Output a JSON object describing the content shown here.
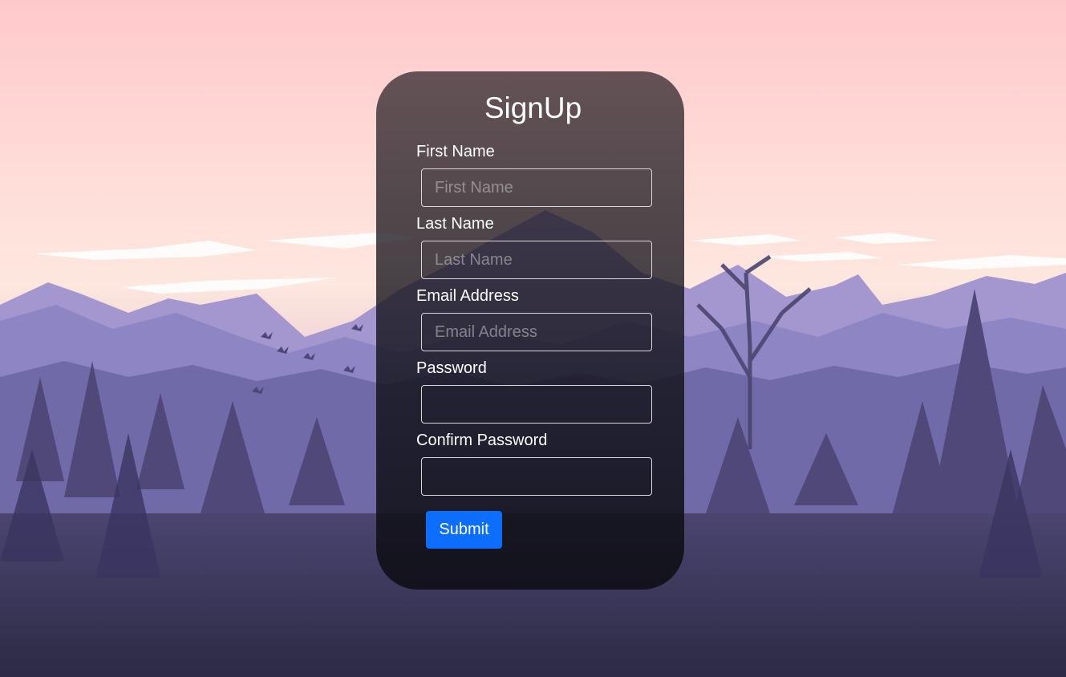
{
  "form": {
    "title": "SignUp",
    "fields": [
      {
        "label": "First Name",
        "placeholder": "First Name",
        "value": ""
      },
      {
        "label": "Last Name",
        "placeholder": "Last Name",
        "value": ""
      },
      {
        "label": "Email Address",
        "placeholder": "Email Address",
        "value": ""
      },
      {
        "label": "Password",
        "placeholder": "",
        "value": ""
      },
      {
        "label": "Confirm Password",
        "placeholder": "",
        "value": ""
      }
    ],
    "submit_label": "Submit"
  },
  "colors": {
    "accent": "#0d6efd",
    "sky_top": "#ffc9cc",
    "mountain": "#8d85c4",
    "forest": "#3b3656"
  }
}
